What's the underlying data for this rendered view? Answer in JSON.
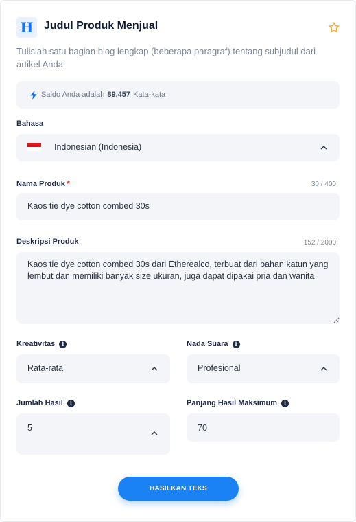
{
  "header": {
    "logo_letter": "H",
    "title": "Judul Produk Menjual",
    "subtitle": "Tulislah satu bagian blog lengkap (beberapa paragraf) tentang subjudul dari artikel Anda"
  },
  "balance": {
    "prefix": "Saldo Anda adalah",
    "amount": "89,457",
    "suffix": "Kata-kata"
  },
  "language": {
    "label": "Bahasa",
    "value": "Indonesian (Indonesia)"
  },
  "product_name": {
    "label": "Nama Produk",
    "required_mark": "*",
    "counter": "30 / 400",
    "value": "Kaos tie dye cotton combed 30s"
  },
  "product_description": {
    "label": "Deskripsi Produk",
    "counter": "152 / 2000",
    "value": "Kaos tie dye cotton combed 30s dari Etherealco, terbuat dari bahan katun yang lembut dan memiliki banyak size ukuran, juga dapat dipakai pria dan wanita"
  },
  "creativity": {
    "label": "Kreativitas",
    "value": "Rata-rata"
  },
  "tone": {
    "label": "Nada Suara",
    "value": "Profesional"
  },
  "result_count": {
    "label": "Jumlah Hasil",
    "value": "5"
  },
  "max_length": {
    "label": "Panjang Hasil Maksimum",
    "value": "70"
  },
  "generate_button": {
    "label": "HASILKAN TEKS"
  },
  "colors": {
    "accent": "#1a82f5",
    "required": "#e53935",
    "star": "#f5a623"
  }
}
